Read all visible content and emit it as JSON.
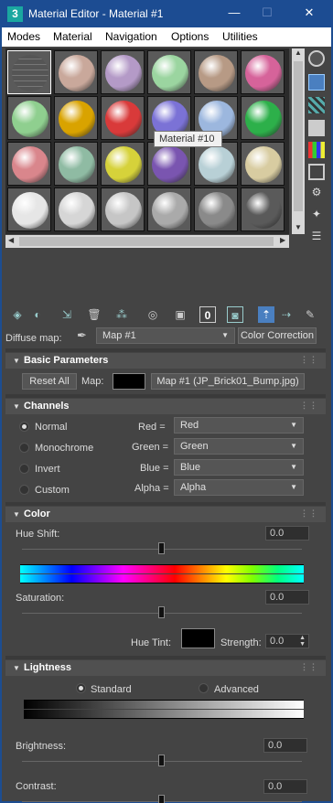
{
  "window": {
    "title": "Material Editor - Material #1",
    "app_icon_glyph": "3",
    "minimize": "—",
    "maximize": "☐",
    "close": "✕"
  },
  "menu": [
    "Modes",
    "Material",
    "Navigation",
    "Options",
    "Utilities"
  ],
  "tooltip": "Material #10",
  "slots": [
    [
      "#6c6c6c",
      "#c9a89b",
      "#b49ac7",
      "#9bd5a0",
      "#b79a85",
      "#d6639a"
    ],
    [
      "#8fcf8f",
      "#d9a300",
      "#d93a3a",
      "#7b72d6",
      "#9cb7de",
      "#2db04a"
    ],
    [
      "#d9868c",
      "#8fbba3",
      "#d6d23a",
      "#7a55b0",
      "#b8d0d6",
      "#d8cca1"
    ],
    [
      "#e6e6e6",
      "#d6d6d6",
      "#c6c6c6",
      "#aaaaaa",
      "#8a8a8a",
      "#5a5a5a"
    ]
  ],
  "diffuse": {
    "label": "Diffuse map:",
    "value": "Map #1",
    "button": "Color Correction"
  },
  "basic": {
    "title": "Basic Parameters",
    "reset": "Reset All",
    "map_label": "Map:",
    "map_button": "Map #1 (JP_Brick01_Bump.jpg)",
    "swatch": "#000000"
  },
  "channels": {
    "title": "Channels",
    "modes": [
      "Normal",
      "Monochrome",
      "Invert",
      "Custom"
    ],
    "mode_selected": "Normal",
    "rows": [
      {
        "label": "Red =",
        "value": "Red"
      },
      {
        "label": "Green =",
        "value": "Green"
      },
      {
        "label": "Blue =",
        "value": "Blue"
      },
      {
        "label": "Alpha =",
        "value": "Alpha"
      }
    ]
  },
  "color": {
    "title": "Color",
    "hue_label": "Hue Shift:",
    "hue_value": "0.0",
    "hue_level": 0.5,
    "sat_label": "Saturation:",
    "sat_value": "0.0",
    "sat_level": 0.5,
    "tint_label": "Hue Tint:",
    "tint_swatch": "#000000",
    "strength_label": "Strength:",
    "strength_value": "0.0"
  },
  "lightness": {
    "title": "Lightness",
    "standard": "Standard",
    "advanced": "Advanced",
    "selected": "Standard",
    "brightness_label": "Brightness:",
    "brightness_value": "0.0",
    "brightness_level": 0.5,
    "contrast_label": "Contrast:",
    "contrast_value": "0.0",
    "contrast_level": 0.5
  }
}
